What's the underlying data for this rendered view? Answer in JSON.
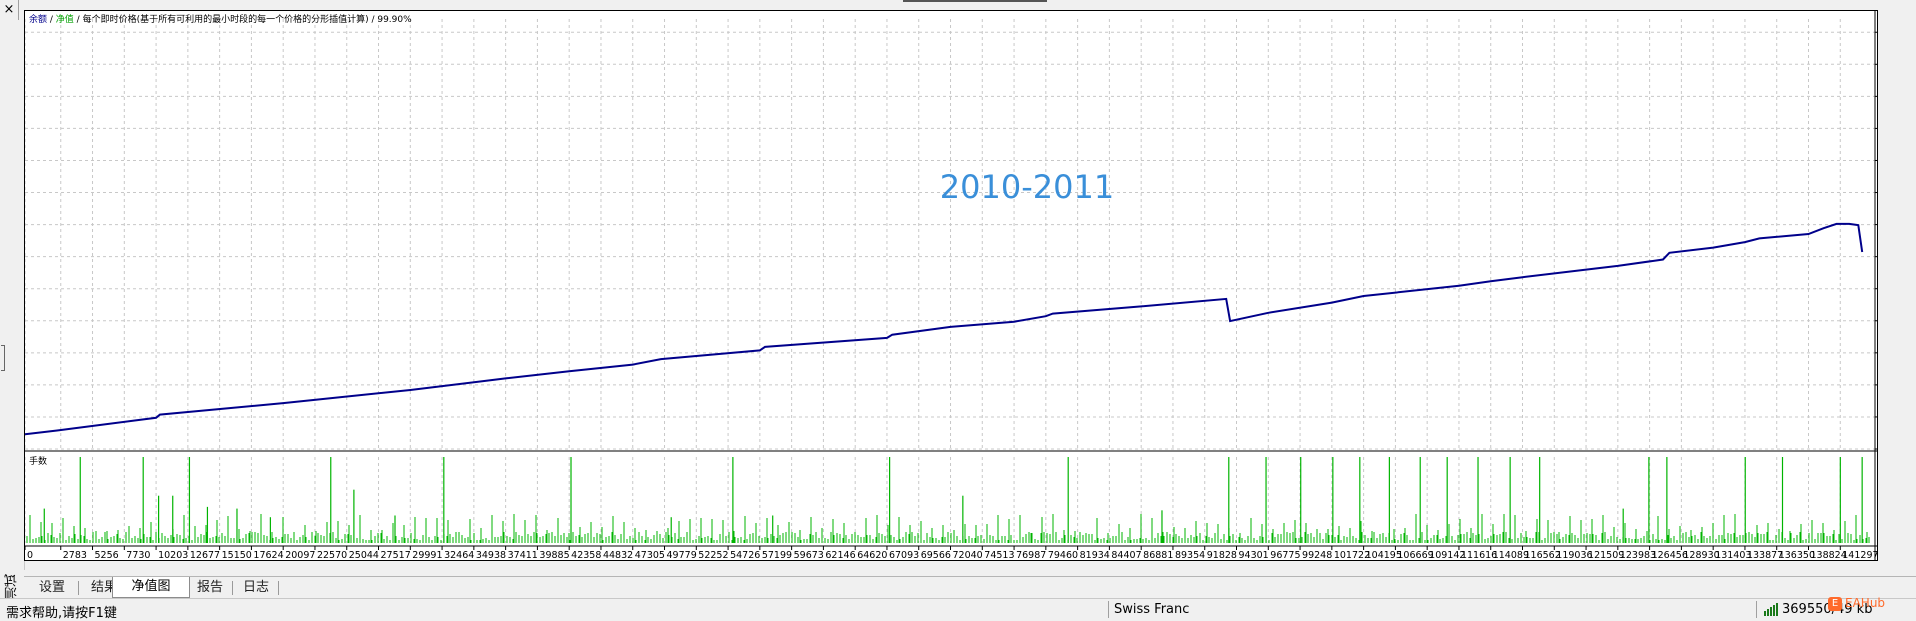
{
  "window": {
    "close_glyph": "×"
  },
  "side_label": "测试",
  "chart": {
    "legend": {
      "balance": "余额",
      "sep1": " / ",
      "equity": "净值",
      "sep2": " / ",
      "model": "每个即时价格(基于所有可利用的最小时段的每一个价格的分形插值计算)",
      "sep3": " / ",
      "quality": "99.90%"
    },
    "annotation": "2010-2011",
    "volume_label": "手数",
    "colors": {
      "line": "#00008b",
      "volume": "#00b400",
      "grid": "#c8c8c8",
      "annotation": "#3a8fd9",
      "balance": "#00008b",
      "equity": "#00a000"
    }
  },
  "chart_data": {
    "type": "line",
    "title": "",
    "y_ticks": [
      "637422",
      "626345",
      "615269",
      "604192",
      "593115",
      "582038",
      "570961",
      "559884",
      "548807",
      "537731",
      "526654",
      "515577",
      "504500",
      "493423"
    ],
    "x_ticks": [
      "0",
      "2783",
      "5256",
      "7730",
      "10203",
      "12677",
      "15150",
      "17624",
      "20097",
      "22570",
      "25044",
      "27517",
      "29991",
      "32464",
      "34938",
      "37411",
      "39885",
      "42358",
      "44832",
      "47305",
      "49779",
      "52252",
      "54726",
      "57199",
      "59673",
      "62146",
      "64620",
      "67093",
      "69566",
      "72040",
      "74513",
      "76987",
      "79460",
      "81934",
      "84407",
      "86881",
      "89354",
      "91828",
      "94301",
      "96775",
      "99248",
      "101722",
      "104195",
      "106669",
      "109142",
      "111616",
      "114089",
      "116562",
      "119036",
      "121509",
      "123983",
      "126456",
      "128930",
      "131403",
      "133877",
      "136350",
      "138824",
      "141297"
    ],
    "ylim": [
      493423,
      642000
    ],
    "xlim": [
      0,
      144000
    ],
    "series": [
      {
        "name": "余额",
        "x": [
          0,
          2500,
          10203,
          10500,
          20097,
          30000,
          37411,
          42358,
          47305,
          49500,
          57199,
          57600,
          67093,
          67500,
          72040,
          76987,
          79460,
          80000,
          86881,
          93500,
          93800,
          96775,
          101722,
          104195,
          111616,
          114089,
          116562,
          121509,
          123983,
          127500,
          128000,
          131403,
          133877,
          135000,
          138824,
          140000,
          141000,
          142000,
          142700,
          143000
        ],
        "y": [
          498500,
          499800,
          504200,
          505300,
          509300,
          513800,
          517800,
          520300,
          522600,
          524500,
          527500,
          528700,
          531800,
          532900,
          535600,
          537400,
          539300,
          540200,
          542700,
          545300,
          537600,
          540500,
          544000,
          546300,
          549800,
          551400,
          552800,
          555400,
          556700,
          558900,
          561200,
          563000,
          564900,
          566200,
          567700,
          569700,
          571200,
          571200,
          570800,
          561500
        ]
      }
    ],
    "volume": {
      "name": "手数",
      "spikes_x": [
        1500,
        4300,
        9200,
        10400,
        11500,
        12800,
        14200,
        16500,
        19100,
        23800,
        25600,
        28800,
        32600,
        42500,
        50300,
        55100,
        58200,
        67300,
        73000,
        81200,
        88500,
        93700,
        96600,
        99300,
        101800,
        103900,
        106200,
        108600,
        110700,
        113100,
        115600,
        117900,
        124400,
        126400,
        127800,
        133900,
        136800,
        141300,
        143000
      ],
      "spikes_h": [
        0.4,
        1.0,
        1.0,
        0.55,
        0.55,
        1.0,
        0.42,
        0.4,
        0.3,
        1.0,
        0.62,
        0.32,
        1.0,
        1.0,
        0.3,
        1.0,
        0.32,
        1.0,
        0.55,
        1.0,
        0.38,
        1.0,
        1.0,
        1.0,
        1.0,
        1.0,
        1.0,
        1.0,
        1.0,
        1.0,
        1.0,
        1.0,
        0.4,
        1.0,
        1.0,
        1.0,
        1.0,
        1.0,
        1.0
      ]
    }
  },
  "tabs": [
    {
      "label": "设置",
      "active": false
    },
    {
      "label": "结果",
      "active": false
    },
    {
      "label": "净值图",
      "active": true
    },
    {
      "label": "报告",
      "active": false
    },
    {
      "label": "日志",
      "active": false
    }
  ],
  "status": {
    "help": "需求帮助,请按F1键",
    "symbol": "Swiss Franc",
    "memory": "369550/49 kb"
  },
  "watermark": {
    "icon": "E",
    "text": "EAHub"
  }
}
